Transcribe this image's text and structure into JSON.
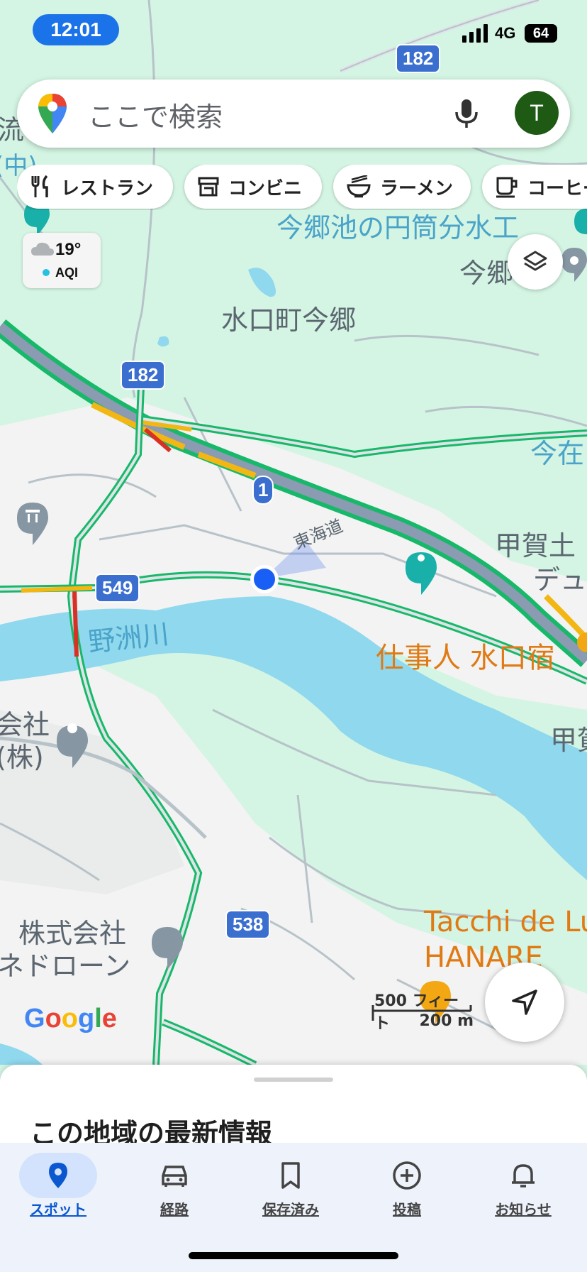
{
  "status_bar": {
    "time": "12:01",
    "network": "4G",
    "battery": "64"
  },
  "search": {
    "placeholder": "ここで検索",
    "avatar_letter": "T"
  },
  "chips": [
    {
      "label": "レストラン",
      "icon": "fork-knife-icon"
    },
    {
      "label": "コンビニ",
      "icon": "store-icon"
    },
    {
      "label": "ラーメン",
      "icon": "ramen-bowl-icon"
    },
    {
      "label": "コーヒー",
      "icon": "coffee-cup-icon"
    }
  ],
  "weather": {
    "temp": "19°",
    "aqi": "AQI"
  },
  "map": {
    "labels": {
      "top_left_fragment": "流",
      "top_left_fragment2": "(中)",
      "waterworks": "今郷池の円筒分水工",
      "imago_fragment": "今郷",
      "district": "水口町今郷",
      "imazai_fragment": "今在",
      "koka_fragment": "甲賀土",
      "dew_fragment": "デュ",
      "tokaido": "東海道",
      "river": "野洲川",
      "shigotonin": "仕事人 水口宿",
      "company_fragment": "会社",
      "kabu_fragment": "(株)",
      "koka2_fragment": "甲賀",
      "company2_line1": "株式会社",
      "company2_line2": "ネドローン",
      "tacchi_line1": "Tacchi de Lu",
      "tacchi_line2": "HANARE"
    },
    "route_shields": [
      "182",
      "182",
      "1",
      "549",
      "538"
    ],
    "scale": {
      "feet": "500 フィート",
      "meters": "200 m"
    },
    "logo": "Google"
  },
  "sheet": {
    "title": "この地域の最新情報"
  },
  "nav": [
    {
      "label": "スポット",
      "icon": "location-pin-icon",
      "active": true
    },
    {
      "label": "経路",
      "icon": "car-icon",
      "active": false
    },
    {
      "label": "保存済み",
      "icon": "bookmark-icon",
      "active": false
    },
    {
      "label": "投稿",
      "icon": "add-circle-icon",
      "active": false
    },
    {
      "label": "お知らせ",
      "icon": "bell-icon",
      "active": false
    }
  ],
  "colors": {
    "accent": "#1a73e8",
    "water": "#8fd8ee",
    "land": "#d4f5e3",
    "urban": "#f1f3f4",
    "road_traffic": "#18b86a",
    "slow_traffic": "#f3b713",
    "jam_traffic": "#d93025",
    "poi_orange": "#e07a14"
  }
}
